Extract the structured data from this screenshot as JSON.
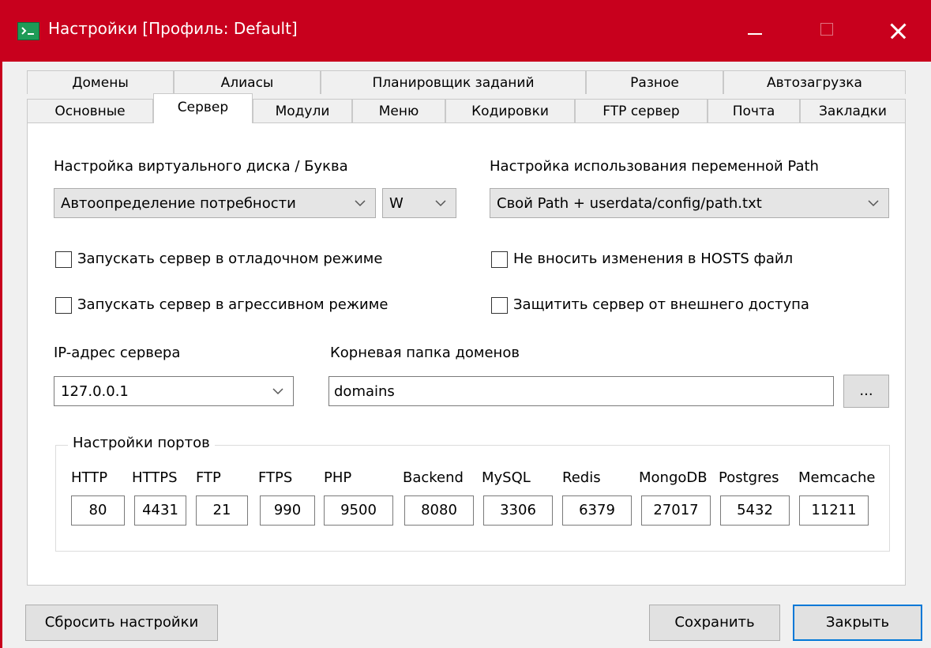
{
  "window": {
    "title": "Настройки [Профиль: Default]",
    "accent_color": "#c8001d"
  },
  "tabs": {
    "row1": [
      "Домены",
      "Алиасы",
      "Планировщик заданий",
      "Разное",
      "Автозагрузка"
    ],
    "row2": [
      "Основные",
      "Сервер",
      "Модули",
      "Меню",
      "Кодировки",
      "FTP сервер",
      "Почта",
      "Закладки"
    ],
    "active": "Сервер"
  },
  "server": {
    "vdisk_label": "Настройка виртуального диска / Буква",
    "vdisk_mode": "Автоопределение потребности",
    "vdisk_letter": "W",
    "path_label": "Настройка использования переменной Path",
    "path_value": "Свой Path + userdata/config/path.txt",
    "checkboxes": {
      "debug": {
        "label": "Запускать сервер в отладочном режиме",
        "checked": false
      },
      "aggressive": {
        "label": "Запускать сервер в агрессивном режиме",
        "checked": false
      },
      "hosts": {
        "label": "Не вносить изменения в HOSTS файл",
        "checked": false
      },
      "protect": {
        "label": "Защитить сервер от внешнего доступа",
        "checked": false
      }
    },
    "ip_label": "IP-адрес сервера",
    "ip_value": "127.0.0.1",
    "root_label": "Корневая папка доменов",
    "root_value": "domains",
    "browse_label": "..."
  },
  "ports": {
    "group_title": "Настройки портов",
    "items": [
      {
        "label": "HTTP",
        "value": "80"
      },
      {
        "label": "HTTPS",
        "value": "4431"
      },
      {
        "label": "FTP",
        "value": "21"
      },
      {
        "label": "FTPS",
        "value": "990"
      },
      {
        "label": "PHP",
        "value": "9500"
      },
      {
        "label": "Backend",
        "value": "8080"
      },
      {
        "label": "MySQL",
        "value": "3306"
      },
      {
        "label": "Redis",
        "value": "6379"
      },
      {
        "label": "MongoDB",
        "value": "27017"
      },
      {
        "label": "Postgres",
        "value": "5432"
      },
      {
        "label": "Memcache",
        "value": "11211"
      }
    ]
  },
  "footer": {
    "reset_label": "Сбросить настройки",
    "save_label": "Сохранить",
    "close_label": "Закрыть"
  }
}
